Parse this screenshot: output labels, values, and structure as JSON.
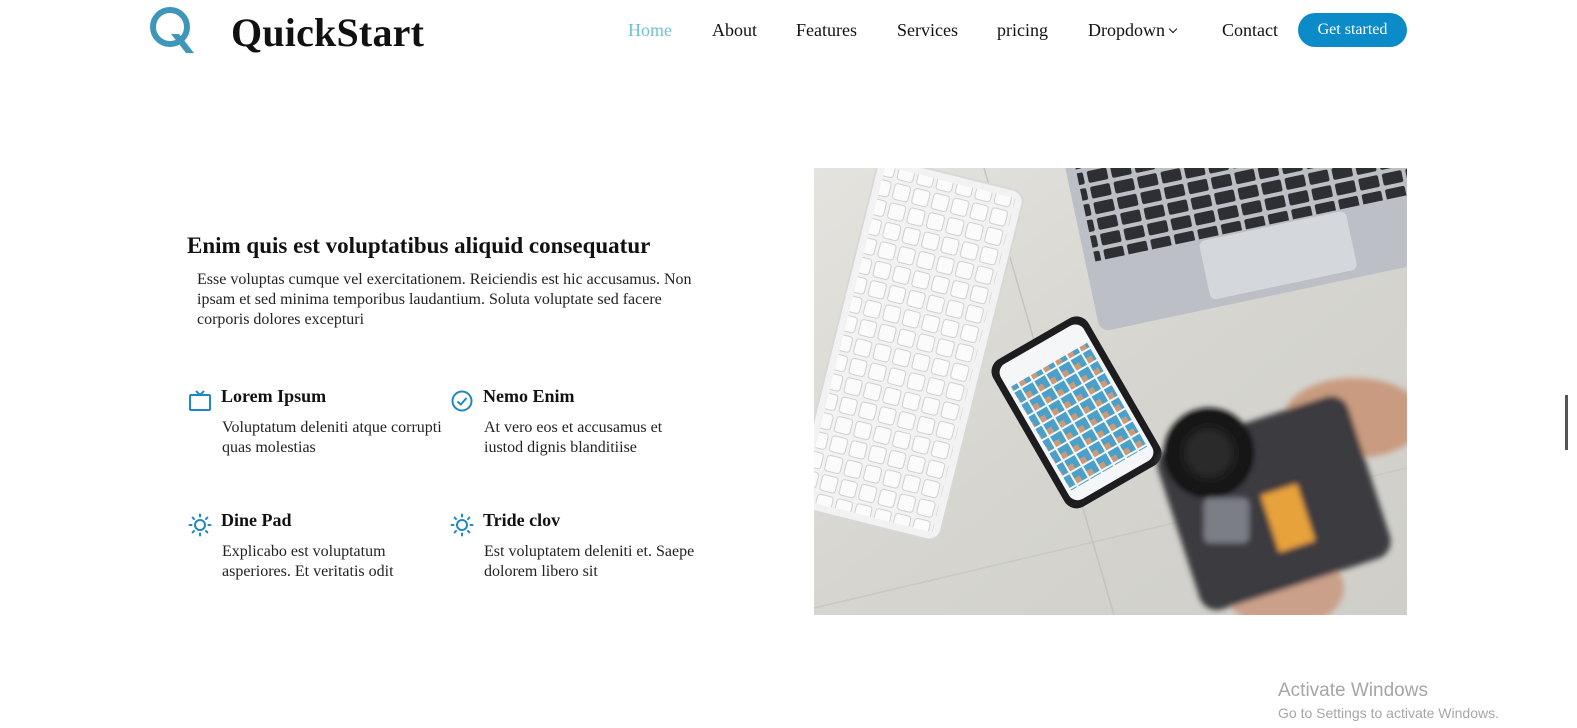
{
  "header": {
    "brand": "QuickStart",
    "logo_letter": "Q",
    "nav": [
      {
        "label": "Home",
        "active": true
      },
      {
        "label": "About",
        "active": false
      },
      {
        "label": "Features",
        "active": false
      },
      {
        "label": "Services",
        "active": false
      },
      {
        "label": "pricing",
        "active": false
      },
      {
        "label": "Dropdown",
        "active": false,
        "has_dropdown": true
      },
      {
        "label": "Contact",
        "active": false
      }
    ],
    "cta": "Get started"
  },
  "about": {
    "title": "Enim quis est voluptatibus aliquid consequatur",
    "intro": "Esse voluptas cumque vel exercitationem. Reiciendis est hic accusamus. Non ipsam et sed minima temporibus laudantium. Soluta voluptate sed facere corporis dolores excepturi",
    "features": [
      {
        "icon": "tv-icon",
        "title": "Lorem Ipsum",
        "desc": "Voluptatum deleniti atque corrupti quas molestias"
      },
      {
        "icon": "check-circle-icon",
        "title": "Nemo Enim",
        "desc": "At vero eos et accusamus et iustod dignis blanditiise"
      },
      {
        "icon": "sun-icon",
        "title": "Dine Pad",
        "desc": "Explicabo est voluptatum asperiores. Et veritatis odit"
      },
      {
        "icon": "sun-icon",
        "title": "Tride clov",
        "desc": "Est voluptatem deleniti et. Saepe dolorem libero sit"
      }
    ],
    "image": "desk-photo-keyboard-laptop-phone-camera"
  },
  "watermark": {
    "line1": "Activate Windows",
    "line2": "Go to Settings to activate Windows."
  },
  "colors": {
    "accent": "#0c8bc9",
    "nav_active": "#6fbfd8",
    "logo": "#3e97b8",
    "icon": "#1e88c3"
  }
}
